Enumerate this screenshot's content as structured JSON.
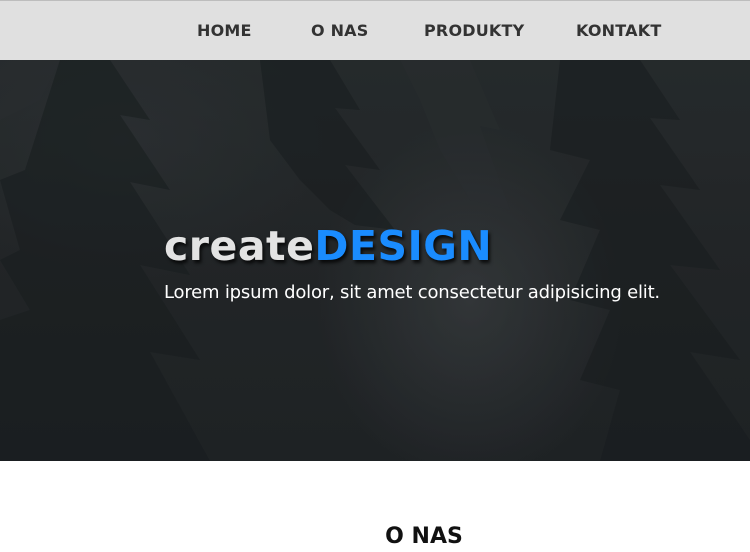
{
  "nav": {
    "items": [
      {
        "label": "HOME"
      },
      {
        "label": "O NAS"
      },
      {
        "label": "PRODUKTY"
      },
      {
        "label": "KONTAKT"
      }
    ],
    "background": "#e0e0e0",
    "text_color": "#333333"
  },
  "hero": {
    "title_part1": "create",
    "title_part2": "DESIGN",
    "subtitle": "Lorem ipsum dolor, sit amet consectetur adipisicing elit.",
    "accent_color": "#1a8cff"
  },
  "section": {
    "title": "O NAS"
  }
}
